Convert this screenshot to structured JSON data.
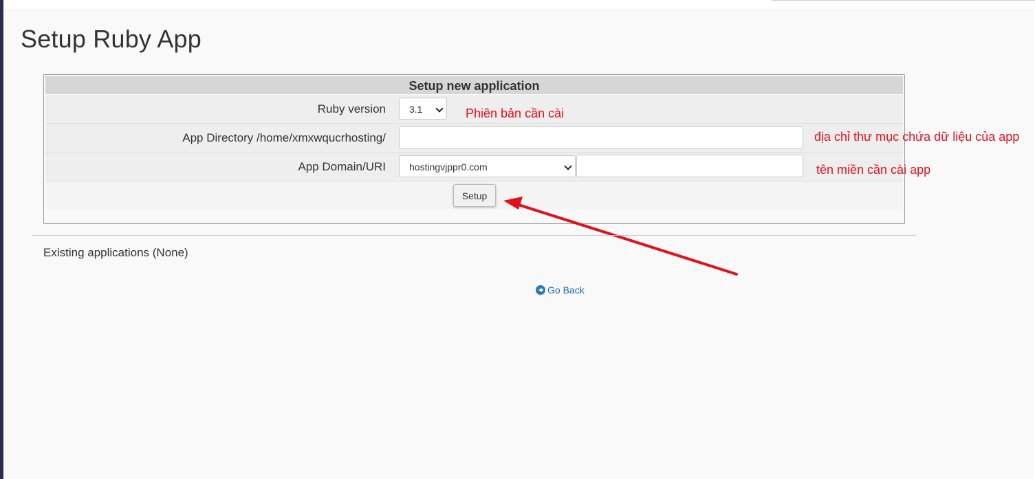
{
  "page": {
    "title": "Setup Ruby App"
  },
  "form": {
    "header": "Setup new application",
    "ruby_version": {
      "label": "Ruby version",
      "selected": "3.1"
    },
    "app_directory": {
      "label": "App Directory /home/xmxwqucrhosting/",
      "value": ""
    },
    "app_domain": {
      "label": "App Domain/URI",
      "domain_selected": "hostingvjppr0.com",
      "uri_value": ""
    },
    "setup_button": "Setup"
  },
  "annotations": {
    "version_note": "Phiên bản cần cài",
    "directory_note": "địa chỉ thư mục chứa dữ liệu của app",
    "domain_note": "tên miền cần cài app",
    "arrow_color": "#e3101b"
  },
  "existing": {
    "text": "Existing applications (None)"
  },
  "go_back": {
    "label": "Go Back",
    "icon": "circle-arrow-left-icon"
  }
}
